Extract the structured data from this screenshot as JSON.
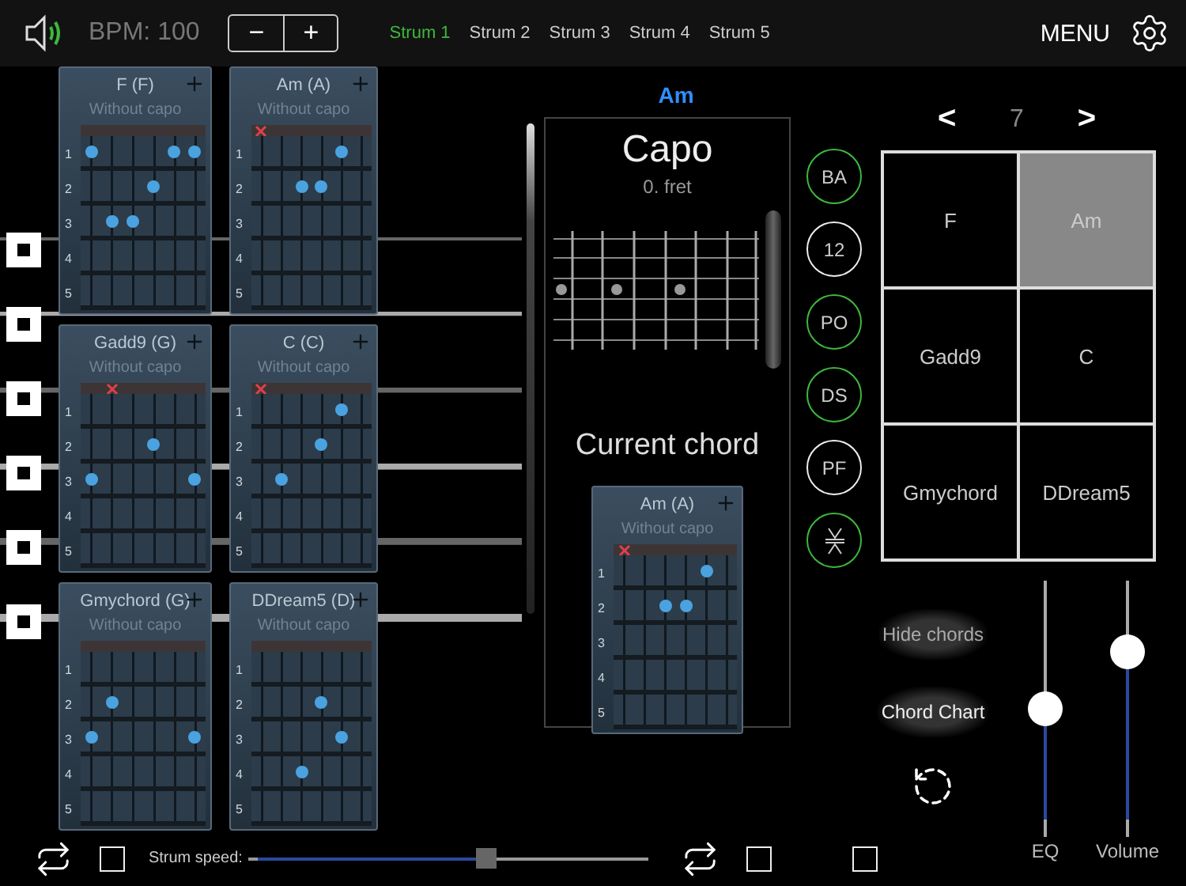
{
  "top_bar": {
    "bpm": "BPM: 100",
    "stepper": [
      "−",
      "+"
    ],
    "strum_tabs": [
      {
        "label": "Strum 1",
        "selected": true
      },
      {
        "label": "Strum 2",
        "selected": false
      },
      {
        "label": "Strum 3",
        "selected": false
      },
      {
        "label": "Strum 4",
        "selected": false
      },
      {
        "label": "Strum 5",
        "selected": false
      }
    ],
    "menu": "MENU"
  },
  "chord_cards": [
    {
      "title": "F (F)",
      "subtitle": "Without capo",
      "muted": [
        false,
        false,
        false,
        false,
        false,
        false
      ],
      "frets": [
        {
          "label": "1",
          "dots": [
            true,
            false,
            false,
            false,
            true,
            true
          ]
        },
        {
          "label": "2",
          "dots": [
            false,
            false,
            false,
            true,
            false,
            false
          ]
        },
        {
          "label": "3",
          "dots": [
            false,
            true,
            true,
            false,
            false,
            false
          ]
        },
        {
          "label": "4",
          "dots": [
            false,
            false,
            false,
            false,
            false,
            false
          ]
        },
        {
          "label": "5",
          "dots": [
            false,
            false,
            false,
            false,
            false,
            false
          ]
        }
      ]
    },
    {
      "title": "Am (A)",
      "subtitle": "Without capo",
      "muted": [
        true,
        false,
        false,
        false,
        false,
        false
      ],
      "frets": [
        {
          "label": "1",
          "dots": [
            false,
            false,
            false,
            false,
            true,
            false
          ]
        },
        {
          "label": "2",
          "dots": [
            false,
            false,
            true,
            true,
            false,
            false
          ]
        },
        {
          "label": "3",
          "dots": [
            false,
            false,
            false,
            false,
            false,
            false
          ]
        },
        {
          "label": "4",
          "dots": [
            false,
            false,
            false,
            false,
            false,
            false
          ]
        },
        {
          "label": "5",
          "dots": [
            false,
            false,
            false,
            false,
            false,
            false
          ]
        }
      ]
    },
    {
      "title": "Gadd9 (G)",
      "subtitle": "Without capo",
      "muted": [
        false,
        true,
        false,
        false,
        false,
        false
      ],
      "frets": [
        {
          "label": "1",
          "dots": [
            false,
            false,
            false,
            false,
            false,
            false
          ]
        },
        {
          "label": "2",
          "dots": [
            false,
            false,
            false,
            true,
            false,
            false
          ]
        },
        {
          "label": "3",
          "dots": [
            true,
            false,
            false,
            false,
            false,
            true
          ]
        },
        {
          "label": "4",
          "dots": [
            false,
            false,
            false,
            false,
            false,
            false
          ]
        },
        {
          "label": "5",
          "dots": [
            false,
            false,
            false,
            false,
            false,
            false
          ]
        }
      ]
    },
    {
      "title": "C (C)",
      "subtitle": "Without capo",
      "muted": [
        true,
        false,
        false,
        false,
        false,
        false
      ],
      "frets": [
        {
          "label": "1",
          "dots": [
            false,
            false,
            false,
            false,
            true,
            false
          ]
        },
        {
          "label": "2",
          "dots": [
            false,
            false,
            false,
            true,
            false,
            false
          ]
        },
        {
          "label": "3",
          "dots": [
            false,
            true,
            false,
            false,
            false,
            false
          ]
        },
        {
          "label": "4",
          "dots": [
            false,
            false,
            false,
            false,
            false,
            false
          ]
        },
        {
          "label": "5",
          "dots": [
            false,
            false,
            false,
            false,
            false,
            false
          ]
        }
      ]
    },
    {
      "title": "Gmychord (G)",
      "subtitle": "Without capo",
      "muted": [
        false,
        false,
        false,
        false,
        false,
        false
      ],
      "frets": [
        {
          "label": "1",
          "dots": [
            false,
            false,
            false,
            false,
            false,
            false
          ]
        },
        {
          "label": "2",
          "dots": [
            false,
            true,
            false,
            false,
            false,
            false
          ]
        },
        {
          "label": "3",
          "dots": [
            true,
            false,
            false,
            false,
            false,
            true
          ]
        },
        {
          "label": "4",
          "dots": [
            false,
            false,
            false,
            false,
            false,
            false
          ]
        },
        {
          "label": "5",
          "dots": [
            false,
            false,
            false,
            false,
            false,
            false
          ]
        }
      ]
    },
    {
      "title": "DDream5 (D)",
      "subtitle": "Without capo",
      "muted": [
        false,
        false,
        false,
        false,
        false,
        false
      ],
      "frets": [
        {
          "label": "1",
          "dots": [
            false,
            false,
            false,
            false,
            false,
            false
          ]
        },
        {
          "label": "2",
          "dots": [
            false,
            false,
            false,
            true,
            false,
            false
          ]
        },
        {
          "label": "3",
          "dots": [
            false,
            false,
            false,
            false,
            true,
            false
          ]
        },
        {
          "label": "4",
          "dots": [
            false,
            false,
            true,
            false,
            false,
            false
          ]
        },
        {
          "label": "5",
          "dots": [
            false,
            false,
            false,
            false,
            false,
            false
          ]
        }
      ]
    }
  ],
  "current_chord_name": "Am",
  "capo": {
    "title": "Capo",
    "fret": "0. fret"
  },
  "current_chord": {
    "heading": "Current chord",
    "card": {
      "title": "Am (A)",
      "subtitle": "Without capo",
      "muted": [
        true,
        false,
        false,
        false,
        false,
        false
      ],
      "frets": [
        {
          "label": "1",
          "dots": [
            false,
            false,
            false,
            false,
            true,
            false
          ]
        },
        {
          "label": "2",
          "dots": [
            false,
            false,
            true,
            true,
            false,
            false
          ]
        },
        {
          "label": "3",
          "dots": [
            false,
            false,
            false,
            false,
            false,
            false
          ]
        },
        {
          "label": "4",
          "dots": [
            false,
            false,
            false,
            false,
            false,
            false
          ]
        },
        {
          "label": "5",
          "dots": [
            false,
            false,
            false,
            false,
            false,
            false
          ]
        }
      ]
    }
  },
  "mode_buttons": [
    {
      "kind": "text",
      "label": "BA",
      "active": true
    },
    {
      "kind": "text",
      "label": "12",
      "active": false
    },
    {
      "kind": "text",
      "label": "PO",
      "active": true
    },
    {
      "kind": "text",
      "label": "DS",
      "active": true
    },
    {
      "kind": "text",
      "label": "PF",
      "active": false
    },
    {
      "kind": "icon",
      "active": true
    }
  ],
  "page_nav": {
    "prev": "<",
    "page": "7",
    "next": ">"
  },
  "chord_grid": [
    {
      "label": "F",
      "selected": false
    },
    {
      "label": "Am",
      "selected": true
    },
    {
      "label": "Gadd9",
      "selected": false
    },
    {
      "label": "C",
      "selected": false
    },
    {
      "label": "Gmychord",
      "selected": false
    },
    {
      "label": "DDream5",
      "selected": false
    }
  ],
  "hide_chords": "Hide chords",
  "chord_chart": "Chord Chart",
  "sliders": [
    {
      "label": "EQ",
      "level": 0.5
    },
    {
      "label": "Volume",
      "level": 0.76
    }
  ],
  "bottom_bar": {
    "left_checkbox": {
      "checked": false
    },
    "strum_speed": {
      "label": "Strum speed:",
      "level": 0.59
    },
    "right_checkbox": {
      "checked": false
    }
  },
  "corner_checkbox": {
    "checked": false
  }
}
